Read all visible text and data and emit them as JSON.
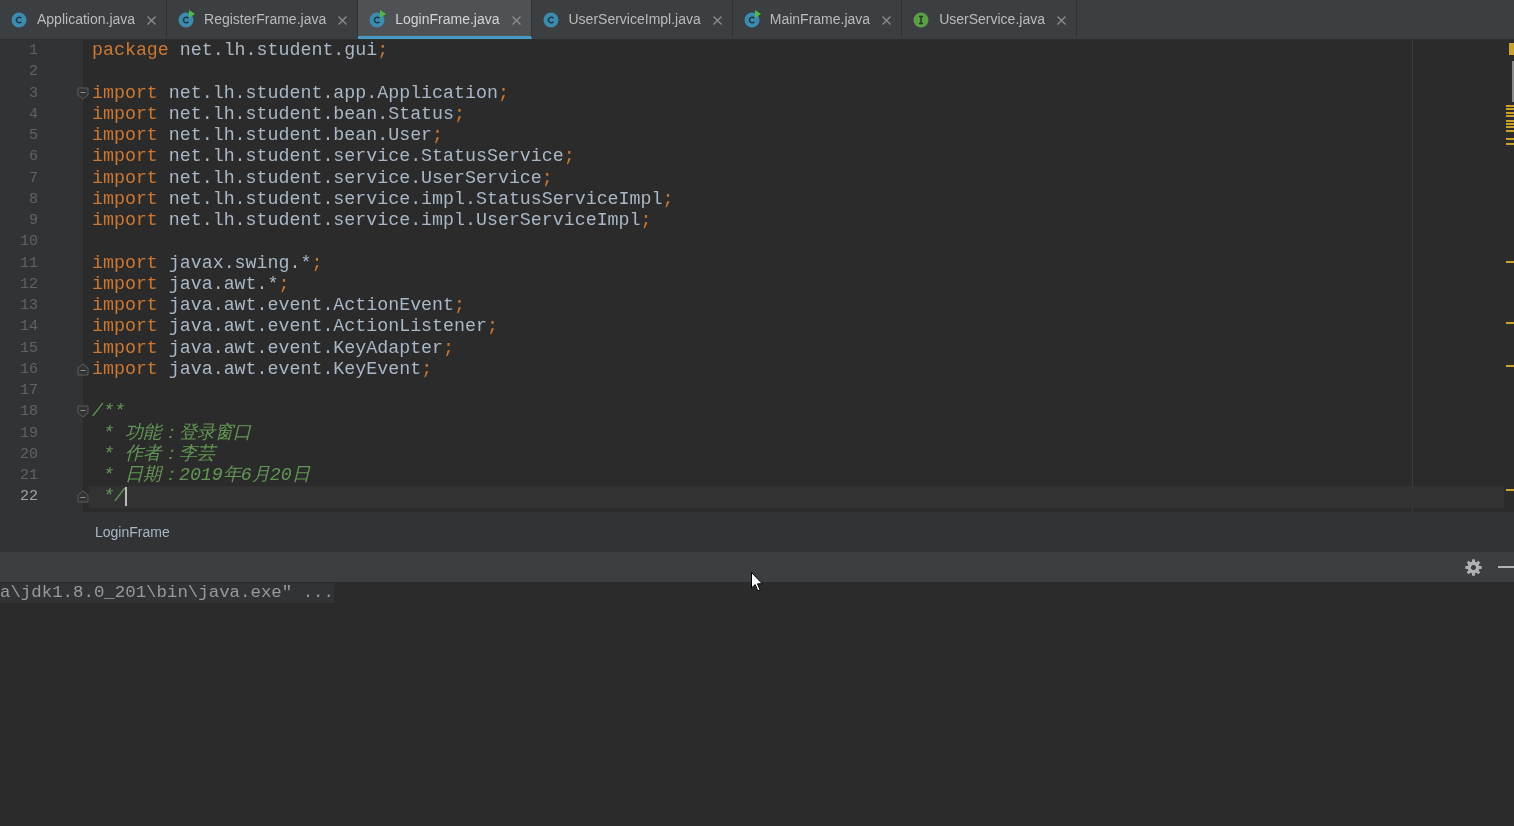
{
  "tabs": [
    {
      "label": "Application.java",
      "kind": "class",
      "runnable": false,
      "selected": false
    },
    {
      "label": "RegisterFrame.java",
      "kind": "class",
      "runnable": true,
      "selected": false
    },
    {
      "label": "LoginFrame.java",
      "kind": "class",
      "runnable": true,
      "selected": true
    },
    {
      "label": "UserServiceImpl.java",
      "kind": "class",
      "runnable": false,
      "selected": false
    },
    {
      "label": "MainFrame.java",
      "kind": "class",
      "runnable": true,
      "selected": false
    },
    {
      "label": "UserService.java",
      "kind": "interface",
      "runnable": false,
      "selected": false
    }
  ],
  "editor": {
    "lines": [
      {
        "number": "1",
        "current": false,
        "tokens": [
          {
            "kind": "keyword",
            "text": "package"
          },
          {
            "kind": "plain",
            "text": " net.lh.student.gui"
          },
          {
            "kind": "keyword",
            "text": ";"
          }
        ]
      },
      {
        "number": "2",
        "current": false
      },
      {
        "number": "3",
        "current": false,
        "fold": {
          "kind": "start"
        },
        "tokens": [
          {
            "kind": "keyword",
            "text": "import"
          },
          {
            "kind": "plain",
            "text": " net.lh.student.app.Application"
          },
          {
            "kind": "keyword",
            "text": ";"
          }
        ]
      },
      {
        "number": "4",
        "current": false,
        "tokens": [
          {
            "kind": "keyword",
            "text": "import"
          },
          {
            "kind": "plain",
            "text": " net.lh.student.bean.Status"
          },
          {
            "kind": "keyword",
            "text": ";"
          }
        ]
      },
      {
        "number": "5",
        "current": false,
        "tokens": [
          {
            "kind": "keyword",
            "text": "import"
          },
          {
            "kind": "plain",
            "text": " net.lh.student.bean.User"
          },
          {
            "kind": "keyword",
            "text": ";"
          }
        ]
      },
      {
        "number": "6",
        "current": false,
        "tokens": [
          {
            "kind": "keyword",
            "text": "import"
          },
          {
            "kind": "plain",
            "text": " net.lh.student.service.StatusService"
          },
          {
            "kind": "keyword",
            "text": ";"
          }
        ]
      },
      {
        "number": "7",
        "current": false,
        "tokens": [
          {
            "kind": "keyword",
            "text": "import"
          },
          {
            "kind": "plain",
            "text": " net.lh.student.service.UserService"
          },
          {
            "kind": "keyword",
            "text": ";"
          }
        ]
      },
      {
        "number": "8",
        "current": false,
        "tokens": [
          {
            "kind": "keyword",
            "text": "import"
          },
          {
            "kind": "plain",
            "text": " net.lh.student.service.impl.StatusServiceImpl"
          },
          {
            "kind": "keyword",
            "text": ";"
          }
        ]
      },
      {
        "number": "9",
        "current": false,
        "tokens": [
          {
            "kind": "keyword",
            "text": "import"
          },
          {
            "kind": "plain",
            "text": " net.lh.student.service.impl.UserServiceImpl"
          },
          {
            "kind": "keyword",
            "text": ";"
          }
        ]
      },
      {
        "number": "10",
        "current": false
      },
      {
        "number": "11",
        "current": false,
        "tokens": [
          {
            "kind": "keyword",
            "text": "import"
          },
          {
            "kind": "plain",
            "text": " javax.swing.*"
          },
          {
            "kind": "keyword",
            "text": ";"
          }
        ]
      },
      {
        "number": "12",
        "current": false,
        "tokens": [
          {
            "kind": "keyword",
            "text": "import"
          },
          {
            "kind": "plain",
            "text": " java.awt.*"
          },
          {
            "kind": "keyword",
            "text": ";"
          }
        ]
      },
      {
        "number": "13",
        "current": false,
        "tokens": [
          {
            "kind": "keyword",
            "text": "import"
          },
          {
            "kind": "plain",
            "text": " java.awt.event.ActionEvent"
          },
          {
            "kind": "keyword",
            "text": ";"
          }
        ]
      },
      {
        "number": "14",
        "current": false,
        "tokens": [
          {
            "kind": "keyword",
            "text": "import"
          },
          {
            "kind": "plain",
            "text": " java.awt.event.ActionListener"
          },
          {
            "kind": "keyword",
            "text": ";"
          }
        ]
      },
      {
        "number": "15",
        "current": false,
        "tokens": [
          {
            "kind": "keyword",
            "text": "import"
          },
          {
            "kind": "plain",
            "text": " java.awt.event.KeyAdapter"
          },
          {
            "kind": "keyword",
            "text": ";"
          }
        ]
      },
      {
        "number": "16",
        "current": false,
        "fold": {
          "kind": "end"
        },
        "tokens": [
          {
            "kind": "keyword",
            "text": "import"
          },
          {
            "kind": "plain",
            "text": " java.awt.event.KeyEvent"
          },
          {
            "kind": "keyword",
            "text": ";"
          }
        ]
      },
      {
        "number": "17",
        "current": false
      },
      {
        "number": "18",
        "current": false,
        "fold": {
          "kind": "start"
        },
        "tokens": [
          {
            "kind": "doc",
            "text": "/**"
          }
        ]
      },
      {
        "number": "19",
        "current": false,
        "tokens": [
          {
            "kind": "doc",
            "text": " * 功能：登录窗口"
          }
        ]
      },
      {
        "number": "20",
        "current": false,
        "tokens": [
          {
            "kind": "doc",
            "text": " * 作者：李芸"
          }
        ]
      },
      {
        "number": "21",
        "current": false,
        "tokens": [
          {
            "kind": "doc",
            "text": " * 日期：2019年6月20日"
          }
        ]
      },
      {
        "number": "22",
        "current": true,
        "fold": {
          "kind": "end"
        },
        "tokens": [
          {
            "kind": "doc",
            "text": " */"
          }
        ]
      }
    ]
  },
  "breadcrumb": [
    "LoginFrame"
  ],
  "console": {
    "lines": [
      "a\\jdk1.8.0_201\\bin\\java.exe\" ..."
    ]
  }
}
